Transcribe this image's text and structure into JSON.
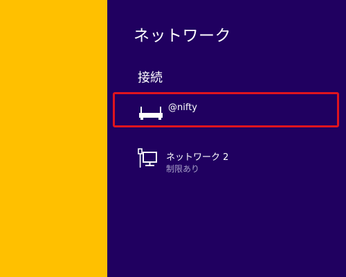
{
  "panel": {
    "title": "ネットワーク",
    "section_title": "接続",
    "networks": [
      {
        "name": "@nifty",
        "icon": "wired-router-icon",
        "highlighted": true
      },
      {
        "name": "ネットワーク 2",
        "status": "制限あり",
        "icon": "wired-computer-icon",
        "highlighted": false
      }
    ]
  },
  "colors": {
    "panel_background": "#200060",
    "left_background": "#ffc000",
    "highlight_border": "#e0141e",
    "status_text": "#a8a0c8"
  }
}
